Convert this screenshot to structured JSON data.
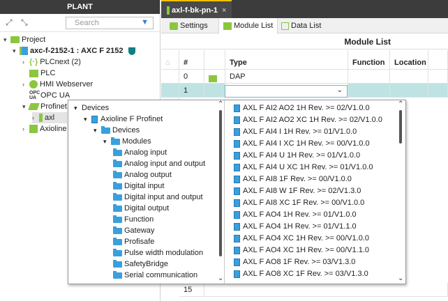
{
  "left_panel": {
    "title": "PLANT",
    "search_placeholder": "Search",
    "tree": [
      {
        "label": "Project",
        "bold": false
      },
      {
        "label": "axc-f-2152-1 : AXC F 2152",
        "bold": true
      },
      {
        "label": "PLCnext (2)",
        "bold": false
      },
      {
        "label": "PLC",
        "bold": false
      },
      {
        "label": "HMI Webserver",
        "bold": false
      },
      {
        "label": "OPC UA",
        "bold": false
      },
      {
        "label": "Profinet",
        "bold": false
      },
      {
        "label": "axl",
        "bold": false
      },
      {
        "label": "Axioline",
        "bold": false
      }
    ]
  },
  "editor": {
    "tab_label": "axl-f-bk-pn-1",
    "close_glyph": "×",
    "subtabs": [
      "Settings",
      "Module List",
      "Data List"
    ],
    "module_list_title": "Module List",
    "columns": [
      "#",
      "Type",
      "Function",
      "Location"
    ],
    "rows": [
      {
        "num": "0",
        "type": "DAP"
      },
      {
        "num": "1",
        "type": ""
      }
    ],
    "last_row_num": "15"
  },
  "popup": {
    "tree": [
      {
        "label": "Devices",
        "level": 0,
        "arrow": "▾"
      },
      {
        "label": "Axioline F Profinet",
        "level": 1,
        "arrow": "▾"
      },
      {
        "label": "Devices",
        "level": 2,
        "arrow": "▾"
      },
      {
        "label": "Modules",
        "level": 3,
        "arrow": "▾"
      },
      {
        "label": "Analog input",
        "level": 4
      },
      {
        "label": "Analog input and output",
        "level": 4
      },
      {
        "label": "Analog output",
        "level": 4
      },
      {
        "label": "Digital input",
        "level": 4
      },
      {
        "label": "Digital input and output",
        "level": 4
      },
      {
        "label": "Digital output",
        "level": 4
      },
      {
        "label": "Function",
        "level": 4
      },
      {
        "label": "Gateway",
        "level": 4
      },
      {
        "label": "Profisafe",
        "level": 4
      },
      {
        "label": "Pulse width modulation",
        "level": 4
      },
      {
        "label": "SafetyBridge",
        "level": 4
      },
      {
        "label": "Serial communication",
        "level": 4
      }
    ],
    "modules": [
      "AXL F AI2 AO2 1H Rev. >= 02/V1.0.0",
      "AXL F AI2 AO2 XC 1H Rev. >= 02/V1.0.0",
      "AXL F AI4 I 1H Rev. >= 01/V1.0.0",
      "AXL F AI4 I XC 1H Rev. >= 00/V1.0.0",
      "AXL F AI4 U 1H Rev. >= 01/V1.0.0",
      "AXL F AI4 U XC 1H Rev. >= 01/V1.0.0",
      "AXL F AI8 1F Rev. >= 00/V1.0.0",
      "AXL F AI8 W 1F Rev. >= 02/V1.3.0",
      "AXL F AI8 XC 1F Rev. >= 00/V1.0.0",
      "AXL F AO4 1H Rev. >= 01/V1.0.0",
      "AXL F AO4 1H Rev. >= 01/V1.1.0",
      "AXL F AO4 XC 1H Rev. >= 00/V1.0.0",
      "AXL F AO4 XC 1H Rev. >= 00/V1.1.0",
      "AXL F AO8 1F Rev. >= 03/V1.3.0",
      "AXL F AO8 XC 1F Rev. >= 03/V1.3.0"
    ]
  },
  "colors": {
    "accent": "#3aa0dc",
    "selection_row": "#bfe3e3",
    "header_dark": "#3c3c3c"
  }
}
